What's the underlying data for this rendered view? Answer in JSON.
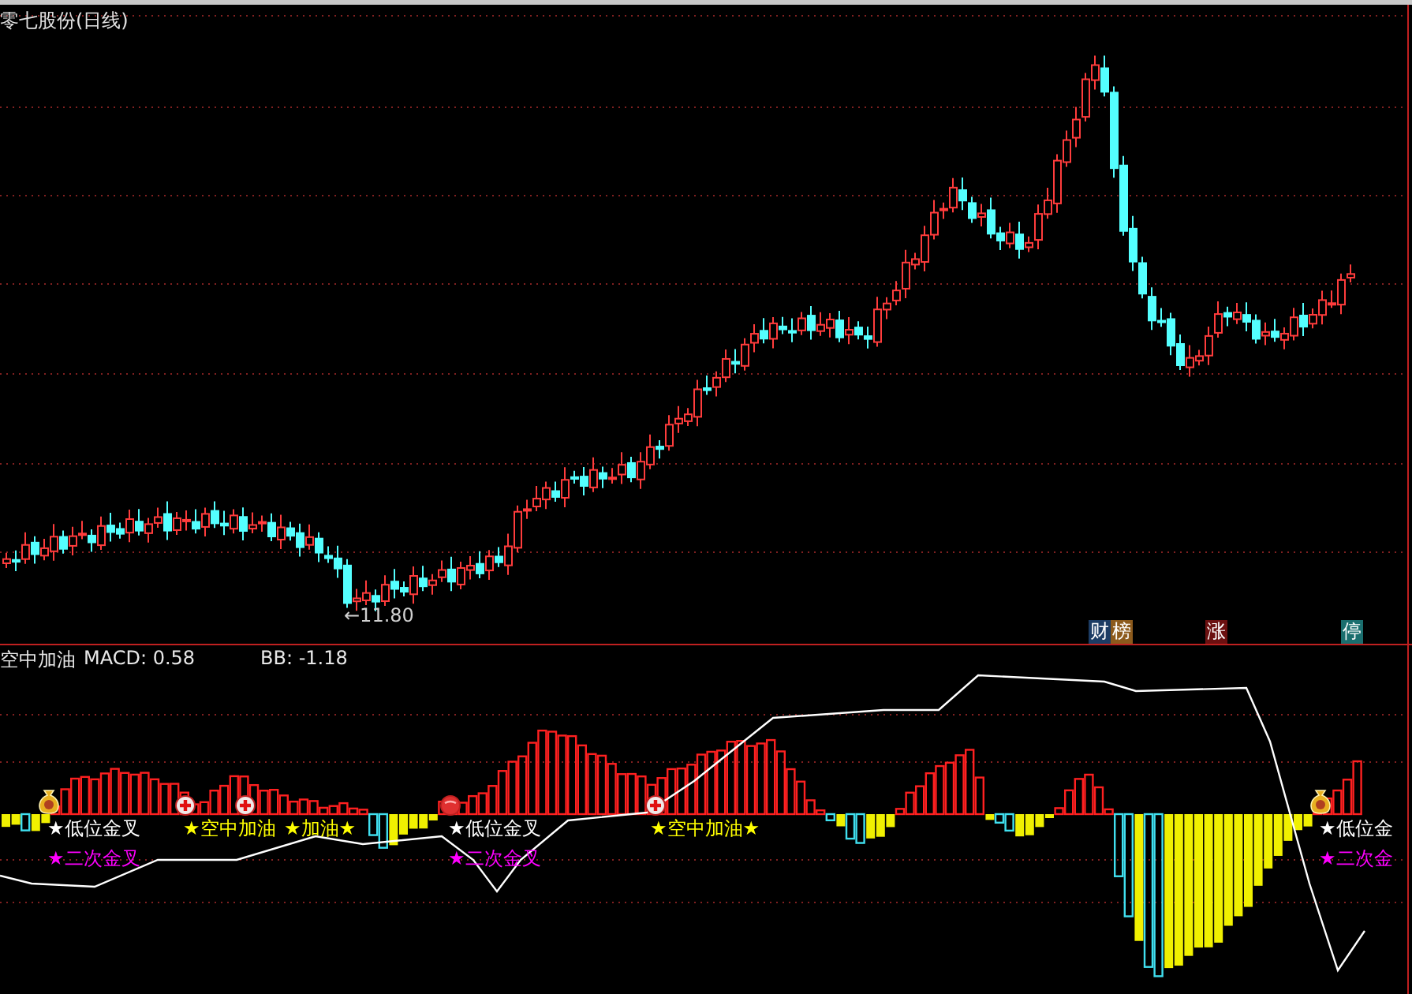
{
  "chart": {
    "title": "零七股份(日线)",
    "low_label": "←11.80",
    "badges": [
      {
        "text": "财",
        "color": "#1c3c64"
      },
      {
        "text": "榜",
        "color": "#8c5a1c"
      },
      {
        "text": "涨",
        "color": "#6c1010"
      },
      {
        "text": "停",
        "color": "#1a6e6e"
      }
    ]
  },
  "indicator": {
    "name": "空中加油",
    "macd": "MACD: 0.58",
    "bb": "BB: -1.18",
    "signals": [
      {
        "text": "★低位金叉",
        "kind": "low"
      },
      {
        "text": "★二次金叉",
        "kind": "second"
      },
      {
        "text": "★空中加油",
        "kind": "refuel"
      },
      {
        "text": "★加油★",
        "kind": "refuel"
      },
      {
        "text": "★低位金叉",
        "kind": "low"
      },
      {
        "text": "★二次金叉",
        "kind": "second"
      },
      {
        "text": "★空中加油★",
        "kind": "refuel"
      },
      {
        "text": "★低位金",
        "kind": "low"
      },
      {
        "text": "★二次金",
        "kind": "second"
      }
    ]
  }
}
